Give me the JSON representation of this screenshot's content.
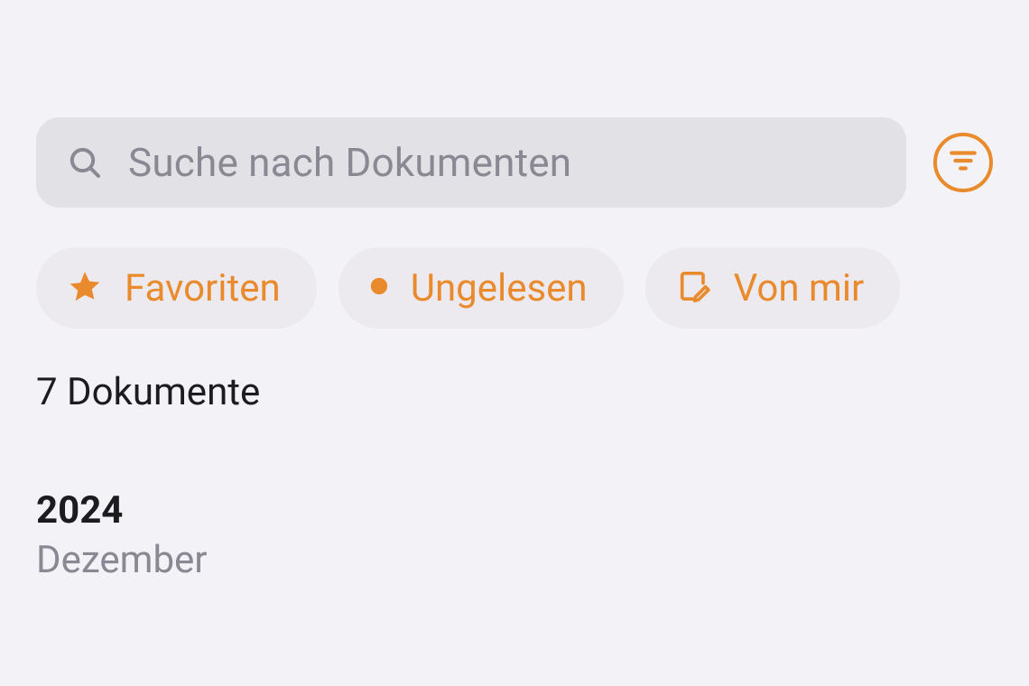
{
  "search": {
    "placeholder": "Suche nach Dokumenten"
  },
  "chips": {
    "favorites": "Favoriten",
    "unread": "Ungelesen",
    "mine": "Von mir"
  },
  "count_label": "7 Dokumente",
  "year": "2024",
  "month": "Dezember",
  "accent": "#e98b2d"
}
